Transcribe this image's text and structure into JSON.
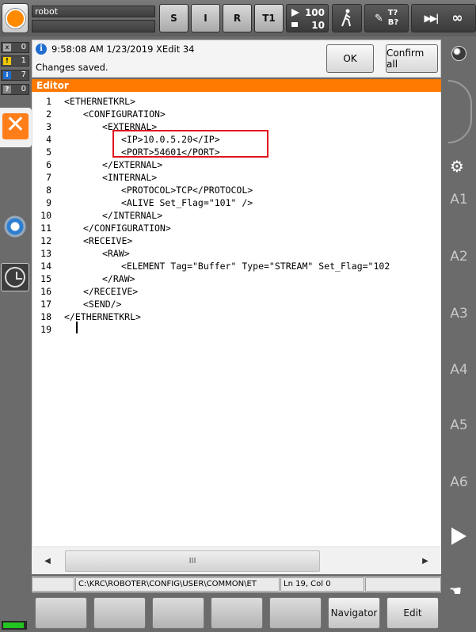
{
  "topbar": {
    "robot_name": "robot",
    "mode_buttons": [
      "S",
      "I",
      "R",
      "T1"
    ],
    "override_run": "100",
    "override_jog": "10",
    "tool_base": "T?\nB?",
    "increment": "∞"
  },
  "status_counts": [
    {
      "icon": "x",
      "count": "0"
    },
    {
      "icon": "!",
      "count": "1"
    },
    {
      "icon": "i",
      "count": "7"
    },
    {
      "icon": "?",
      "count": "0"
    }
  ],
  "message": {
    "time": "9:58:08 AM 1/23/2019 XEdit 34",
    "text": "Changes saved.",
    "ok_label": "OK",
    "confirm_all_label": "Confirm all"
  },
  "editor": {
    "title": "Editor",
    "lines": [
      {
        "n": "1",
        "indent": 0,
        "text": "<ETHERNETKRL>"
      },
      {
        "n": "2",
        "indent": 1,
        "text": "<CONFIGURATION>"
      },
      {
        "n": "3",
        "indent": 2,
        "text": "<EXTERNAL>"
      },
      {
        "n": "4",
        "indent": 3,
        "text": "<IP>10.0.5.20</IP>"
      },
      {
        "n": "5",
        "indent": 3,
        "text": "<PORT>54601</PORT>"
      },
      {
        "n": "6",
        "indent": 2,
        "text": "</EXTERNAL>"
      },
      {
        "n": "7",
        "indent": 2,
        "text": "<INTERNAL>"
      },
      {
        "n": "8",
        "indent": 3,
        "text": "<PROTOCOL>TCP</PROTOCOL>"
      },
      {
        "n": "9",
        "indent": 3,
        "text": "<ALIVE Set_Flag=\"101\" />"
      },
      {
        "n": "10",
        "indent": 2,
        "text": "</INTERNAL>"
      },
      {
        "n": "11",
        "indent": 1,
        "text": "</CONFIGURATION>"
      },
      {
        "n": "12",
        "indent": 1,
        "text": "<RECEIVE>"
      },
      {
        "n": "13",
        "indent": 2,
        "text": "<RAW>"
      },
      {
        "n": "14",
        "indent": 3,
        "text": "<ELEMENT Tag=\"Buffer\" Type=\"STREAM\" Set_Flag=\"102"
      },
      {
        "n": "15",
        "indent": 2,
        "text": "</RAW>"
      },
      {
        "n": "16",
        "indent": 1,
        "text": "</RECEIVE>"
      },
      {
        "n": "17",
        "indent": 1,
        "text": "<SEND/>"
      },
      {
        "n": "18",
        "indent": 0,
        "text": "</ETHERNETKRL>"
      },
      {
        "n": "19",
        "indent": 0,
        "text": ""
      }
    ]
  },
  "scrollbar": {
    "thumb_grip": "III"
  },
  "statusbar": {
    "path": "C:\\KRC\\ROBOTER\\CONFIG\\USER\\COMMON\\ET",
    "position": "Ln 19, Col 0"
  },
  "bottom_buttons": {
    "navigator": "Navigator",
    "edit": "Edit"
  },
  "right_labels": [
    "A1",
    "A2",
    "A3",
    "A4",
    "A5",
    "A6"
  ]
}
